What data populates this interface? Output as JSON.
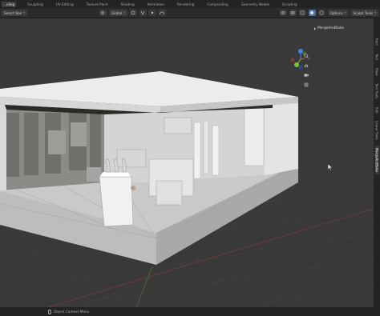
{
  "workspace_tabs": [
    "...eling",
    "Sculpting",
    "UV Editing",
    "Texture Paint",
    "Shading",
    "Animation",
    "Rendering",
    "Compositing",
    "Geometry Nodes",
    "Scripting"
  ],
  "active_tab_index": 0,
  "header": {
    "select_mode": "Select Box",
    "orientation": "Global",
    "options_label": "Options",
    "sculpt_tools_label": "Sculpt Tools"
  },
  "outliner": {
    "object_name": "MergeAndBake"
  },
  "npanel_tabs": [
    "Item",
    "Tool",
    "View",
    "Text Tools",
    "Edit",
    "Linear Tools",
    "MergeAndBake"
  ],
  "npanel_active_index": 6,
  "status": {
    "mouse_hint": "Object Context Menu"
  },
  "icons": {
    "cursor": "mouse-pointer-icon",
    "gizmo": "navigation-gizmo-icon",
    "zoom": "zoom-icon",
    "pan": "hand-pan-icon",
    "camera": "camera-icon",
    "grid": "grid-icon"
  },
  "colors": {
    "viewport_bg": "#393939",
    "active_accent": "#4a6fa5",
    "axis_x": "#d8484f",
    "axis_y": "#7ec33d",
    "axis_z": "#3f86e6"
  }
}
